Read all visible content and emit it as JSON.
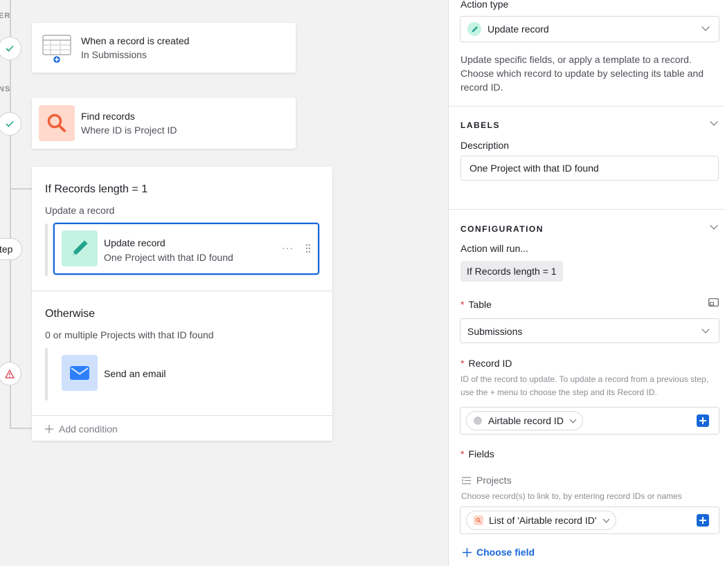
{
  "canvas": {
    "section_labels": {
      "trigger": "ER",
      "actions": "NS"
    },
    "step_pill": "tep",
    "trigger_card": {
      "title": "When a record is created",
      "subtitle": "In Submissions"
    },
    "find_card": {
      "title": "Find records",
      "subtitle": "Where ID is Project ID"
    },
    "condition_group": {
      "if_title": "If Records length = 1",
      "if_subtitle": "Update a record",
      "if_action": {
        "title": "Update record",
        "subtitle": "One Project with that ID found"
      },
      "otherwise_title": "Otherwise",
      "otherwise_subtitle": "0 or multiple Projects with that ID found",
      "otherwise_action": {
        "title": "Send an email"
      },
      "add_condition": "Add condition"
    }
  },
  "panel": {
    "action_type_label": "Action type",
    "action_type_value": "Update record",
    "action_type_help": "Update specific fields, or apply a template to a record. Choose which record to update by selecting its table and record ID.",
    "labels_section": "LABELS",
    "description_label": "Description",
    "description_value": "One Project with that ID found",
    "config_section": "CONFIGURATION",
    "action_will_run": "Action will run...",
    "condition_chip": "If Records length = 1",
    "table_label": "Table",
    "table_value": "Submissions",
    "record_id_label": "Record ID",
    "record_id_help": "ID of the record to update. To update a record from a previous step, use the + menu to choose the step and its Record ID.",
    "record_id_token": "Airtable record ID",
    "fields_label": "Fields",
    "projects_label": "Projects",
    "projects_help": "Choose record(s) to link to, by entering record IDs or names",
    "projects_token": "List of 'Airtable record ID'",
    "choose_field": "Choose field"
  },
  "colors": {
    "accent": "#1767d8",
    "teal_tile": "#c4f2e3",
    "teal_icon": "#20a48a",
    "orange_tile": "#ffd9cc",
    "orange_icon": "#f0603a",
    "blue_tile": "#cfe0fc",
    "blue_icon": "#2d7ff9",
    "required": "#d5354a",
    "warning": "#d5354a"
  }
}
